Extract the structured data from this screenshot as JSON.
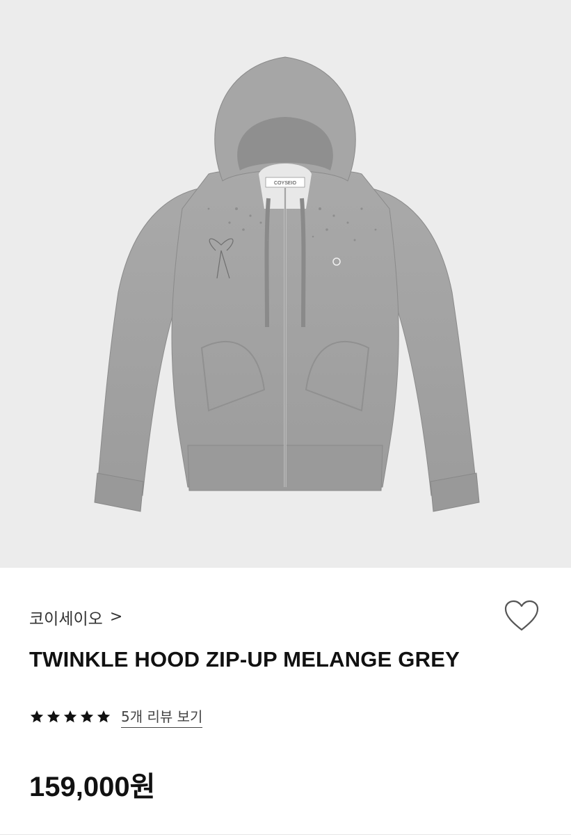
{
  "product": {
    "image_alt": "TWINKLE HOOD ZIP-UP MELANGE GREY",
    "label_tag_text": "COYSEIO",
    "image_background": "#ececec",
    "garment_color": "#a4a4a4",
    "brand": "코이세이오",
    "brand_chevron": ">",
    "title": "TWINKLE HOOD ZIP-UP MELANGE GREY",
    "rating": 5,
    "rating_max": 5,
    "review_link": "5개 리뷰 보기",
    "price": "159,000원",
    "wishlist_icon": "heart-outline-icon"
  }
}
